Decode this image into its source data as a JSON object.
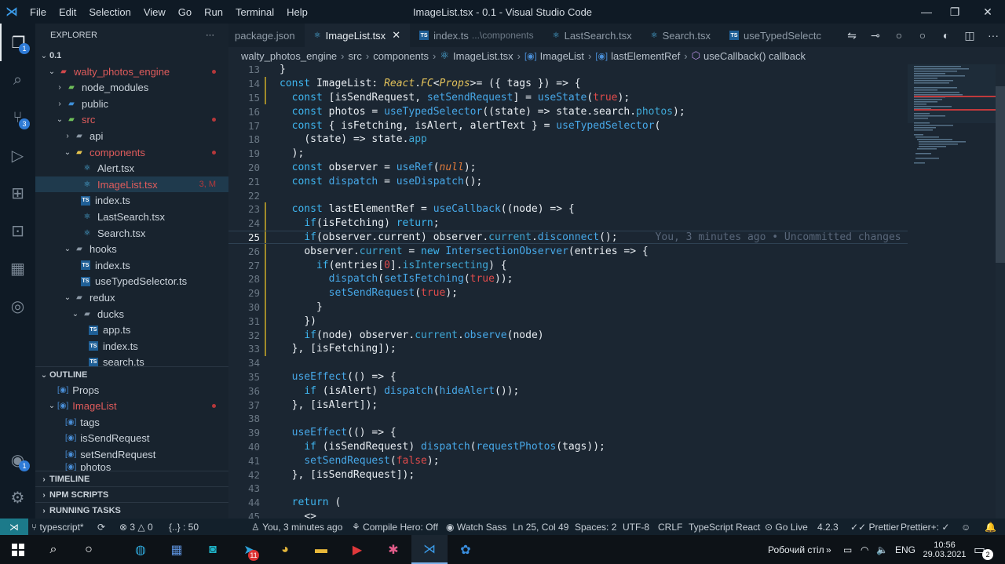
{
  "window": {
    "title": "ImageList.tsx - 0.1 - Visual Studio Code",
    "menu": [
      "File",
      "Edit",
      "Selection",
      "View",
      "Go",
      "Run",
      "Terminal",
      "Help"
    ]
  },
  "activity": {
    "explorer_badge": "1",
    "scm_badge": "3",
    "accounts_badge": "1"
  },
  "explorer": {
    "header": "EXPLORER",
    "root": "0.1",
    "items": [
      {
        "label": "walty_photos_engine",
        "indent": 1,
        "type": "folder",
        "open": true,
        "mod": true
      },
      {
        "label": "node_modules",
        "indent": 2,
        "type": "folder-green",
        "open": false
      },
      {
        "label": "public",
        "indent": 2,
        "type": "folder-blue",
        "open": false
      },
      {
        "label": "src",
        "indent": 2,
        "type": "folder-green",
        "open": true,
        "mod": true
      },
      {
        "label": "api",
        "indent": 3,
        "type": "folder",
        "open": false
      },
      {
        "label": "components",
        "indent": 3,
        "type": "folder-yellow",
        "open": true,
        "mod": true
      },
      {
        "label": "Alert.tsx",
        "indent": 4,
        "type": "react"
      },
      {
        "label": "ImageList.tsx",
        "indent": 4,
        "type": "react",
        "mod": true,
        "selected": true,
        "status": "3, M"
      },
      {
        "label": "index.ts",
        "indent": 4,
        "type": "ts"
      },
      {
        "label": "LastSearch.tsx",
        "indent": 4,
        "type": "react"
      },
      {
        "label": "Search.tsx",
        "indent": 4,
        "type": "react"
      },
      {
        "label": "hooks",
        "indent": 3,
        "type": "folder",
        "open": true
      },
      {
        "label": "index.ts",
        "indent": 4,
        "type": "ts"
      },
      {
        "label": "useTypedSelector.ts",
        "indent": 4,
        "type": "ts"
      },
      {
        "label": "redux",
        "indent": 3,
        "type": "folder",
        "open": true
      },
      {
        "label": "ducks",
        "indent": 4,
        "type": "folder",
        "open": true
      },
      {
        "label": "app.ts",
        "indent": 5,
        "type": "ts"
      },
      {
        "label": "index.ts",
        "indent": 5,
        "type": "ts"
      },
      {
        "label": "search.ts",
        "indent": 5,
        "type": "ts"
      }
    ]
  },
  "outline": {
    "header": "OUTLINE",
    "items": [
      {
        "label": "Props",
        "indent": 1
      },
      {
        "label": "ImageList",
        "indent": 1,
        "open": true,
        "mod": true
      },
      {
        "label": "tags",
        "indent": 2
      },
      {
        "label": "isSendRequest",
        "indent": 2
      },
      {
        "label": "setSendRequest",
        "indent": 2
      },
      {
        "label": "photos",
        "indent": 2
      }
    ]
  },
  "panels": [
    "TIMELINE",
    "NPM SCRIPTS",
    "RUNNING TASKS"
  ],
  "tabs": [
    {
      "label": "package.json",
      "icon": "json"
    },
    {
      "label": "ImageList.tsx",
      "icon": "react",
      "active": true
    },
    {
      "label": "index.ts",
      "icon": "ts",
      "sub": "...\\components"
    },
    {
      "label": "LastSearch.tsx",
      "icon": "react"
    },
    {
      "label": "Search.tsx",
      "icon": "react"
    },
    {
      "label": "useTypedSelectc",
      "icon": "ts"
    }
  ],
  "breadcrumb": [
    "walty_photos_engine",
    "src",
    "components",
    "ImageList.tsx",
    "ImageList",
    "lastElementRef",
    "useCallback() callback"
  ],
  "code": {
    "current_line": 25,
    "blame": "You, 3 minutes ago • Uncommitted changes",
    "lines": [
      {
        "n": 13,
        "t": "}"
      },
      {
        "n": 14,
        "t": "const ImageList: React.FC<Props>= ({ tags }) => {"
      },
      {
        "n": 15,
        "t": "  const [isSendRequest, setSendRequest] = useState(true);"
      },
      {
        "n": 16,
        "t": "  const photos = useTypedSelector((state) => state.search.photos);"
      },
      {
        "n": 17,
        "t": "  const { isFetching, isAlert, alertText } = useTypedSelector("
      },
      {
        "n": 18,
        "t": "    (state) => state.app"
      },
      {
        "n": 19,
        "t": "  );"
      },
      {
        "n": 20,
        "t": "  const observer = useRef(null);"
      },
      {
        "n": 21,
        "t": "  const dispatch = useDispatch();"
      },
      {
        "n": 22,
        "t": ""
      },
      {
        "n": 23,
        "t": "  const lastElementRef = useCallback((node) => {"
      },
      {
        "n": 24,
        "t": "    if(isFetching) return;"
      },
      {
        "n": 25,
        "t": "    if(observer.current) observer.current.disconnect();"
      },
      {
        "n": 26,
        "t": "    observer.current = new IntersectionObserver(entries => {"
      },
      {
        "n": 27,
        "t": "      if(entries[0].isIntersecting) {"
      },
      {
        "n": 28,
        "t": "        dispatch(setIsFetching(true));"
      },
      {
        "n": 29,
        "t": "        setSendRequest(true);"
      },
      {
        "n": 30,
        "t": "      }"
      },
      {
        "n": 31,
        "t": "    })"
      },
      {
        "n": 32,
        "t": "    if(node) observer.current.observe(node)"
      },
      {
        "n": 33,
        "t": "  }, [isFetching]);"
      },
      {
        "n": 34,
        "t": ""
      },
      {
        "n": 35,
        "t": "  useEffect(() => {"
      },
      {
        "n": 36,
        "t": "    if (isAlert) dispatch(hideAlert());"
      },
      {
        "n": 37,
        "t": "  }, [isAlert]);"
      },
      {
        "n": 38,
        "t": ""
      },
      {
        "n": 39,
        "t": "  useEffect(() => {"
      },
      {
        "n": 40,
        "t": "    if (isSendRequest) dispatch(requestPhotos(tags));"
      },
      {
        "n": 41,
        "t": "    setSendRequest(false);"
      },
      {
        "n": 42,
        "t": "  }, [isSendRequest]);"
      },
      {
        "n": 43,
        "t": ""
      },
      {
        "n": 44,
        "t": "  return ("
      },
      {
        "n": 45,
        "t": "    <>"
      }
    ]
  },
  "status": {
    "branch": "typescript*",
    "errors": "3",
    "warnings": "0",
    "selection": "{..} : 50",
    "blame": "You, 3 minutes ago",
    "compile_hero": "Compile Hero: Off",
    "watch_sass": "Watch Sass",
    "position": "Ln 25, Col 49",
    "spaces": "Spaces: 2",
    "encoding": "UTF-8",
    "eol": "CRLF",
    "language": "TypeScript React",
    "go_live": "Go Live",
    "ts_version": "4.2.3",
    "prettier": "Prettier",
    "prettier2": "Prettier+: ✓"
  },
  "taskbar": {
    "desktop_label": "Робочий стіл",
    "lang": "ENG",
    "time": "10:56",
    "date": "29.03.2021",
    "notif_badge": "2",
    "telegram_badge": "11"
  },
  "colors": {
    "accent": "#3b9cea",
    "error": "#e04b4b",
    "status_remote": "#1c7a8a"
  }
}
